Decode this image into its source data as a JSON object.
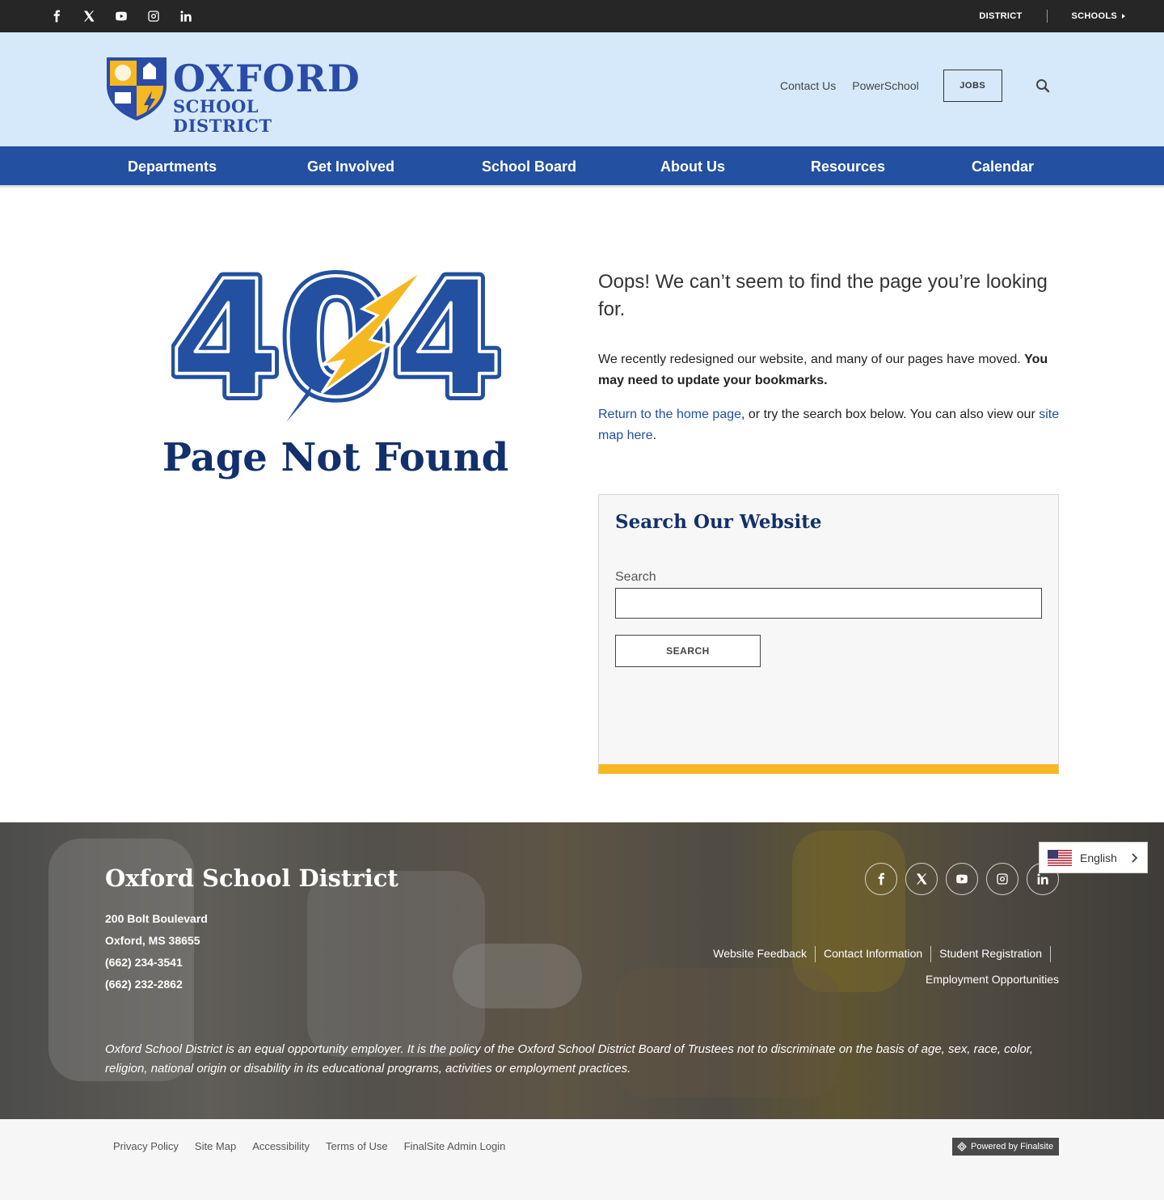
{
  "topbar": {
    "social": [
      "facebook-icon",
      "x-icon",
      "youtube-icon",
      "instagram-icon",
      "linkedin-icon"
    ],
    "district_label": "DISTRICT",
    "schools_label": "SCHOOLS"
  },
  "header": {
    "logo_word1": "OXFORD",
    "logo_word2": "SCHOOL DISTRICT",
    "contact_label": "Contact Us",
    "powerschool_label": "PowerSchool",
    "jobs_label": "JOBS"
  },
  "nav": {
    "items": [
      "Departments",
      "Get Involved",
      "School Board",
      "About Us",
      "Resources",
      "Calendar"
    ]
  },
  "main": {
    "graphic_text": "404",
    "page_title": "Page Not Found",
    "lead": "Oops! We can’t seem to find the page you’re looking for.",
    "p1_text": "We recently redesigned our website, and many of our pages have moved. ",
    "p1_bold": "You may need to update your bookmarks.",
    "p2_link1": "Return to the home page",
    "p2_text": ", or try the search box below. You can also view our ",
    "p2_link2": "site map here",
    "p2_end": "."
  },
  "search": {
    "title": "Search Our Website",
    "label": "Search",
    "value": "",
    "button_label": "SEARCH"
  },
  "footer": {
    "title": "Oxford School District",
    "address_line1": "200 Bolt Boulevard",
    "address_line2": "Oxford, MS  38655",
    "phone": "(662) 234-3541",
    "fax": "(662) 232-2862",
    "links": [
      "Website Feedback",
      "Contact Information",
      "Student Registration",
      "Employment Opportunities"
    ],
    "disclaimer": "Oxford School District is an equal opportunity employer. It is the policy of the Oxford School District Board of Trustees not to discriminate on the basis of age, sex, race, color, religion, national origin or disability in its educational programs, activities or employment practices."
  },
  "language": {
    "selected": "English"
  },
  "bottom": {
    "links": [
      "Privacy Policy",
      "Site Map",
      "Accessibility",
      "Terms of Use",
      "FinalSite Admin Login"
    ],
    "powered_by": "Powered by Finalsite"
  },
  "colors": {
    "nav_blue": "#2350a0",
    "header_bg": "#d6e9fb",
    "navy": "#12306b",
    "gold": "#f5b821",
    "topbar": "#262626"
  }
}
